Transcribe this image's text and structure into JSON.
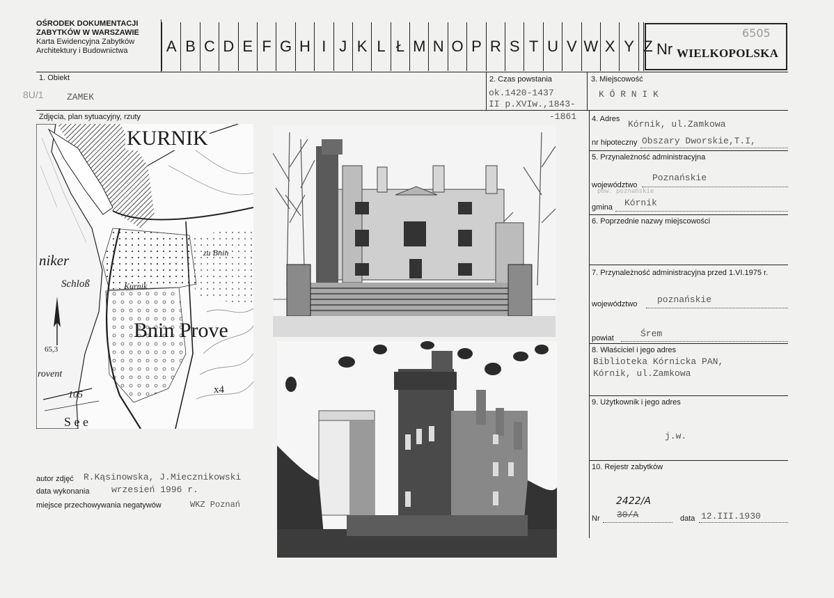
{
  "header": {
    "org_line1": "OŚRODEK DOKUMENTACJI",
    "org_line2": "ZABYTKÓW W WARSZAWIE",
    "org_line3": "Karta Ewidencyjna Zabytków",
    "org_line4": "Architektury i Budownictwa",
    "letters": [
      "A",
      "B",
      "C",
      "D",
      "E",
      "F",
      "G",
      "H",
      "I",
      "J",
      "K",
      "L",
      "Ł",
      "M",
      "N",
      "O",
      "P",
      "R",
      "S",
      "T",
      "U",
      "V",
      "W",
      "X",
      "Y",
      "Z"
    ],
    "nr_label": "Nr",
    "nr_handwritten": "6505",
    "region_stamp": "WIELKOPOLSKA"
  },
  "fields": {
    "obiekt_label": "1. Obiekt",
    "obiekt_margin_note": "8U/1",
    "obiekt_value": "ZAMEK",
    "czas_label": "2. Czas powstania",
    "czas_line1": "ok.1420-1437",
    "czas_line2": "II p.XVIw.,1843-",
    "czas_line3": "-1861",
    "miejscowosc_label": "3. Miejscowość",
    "miejscowosc_value": "K Ó R N I K",
    "zdjecia_label": "Zdjęcia, plan sytuacyjny, rzuty",
    "adres_label": "4. Adres",
    "adres_value": "Kórnik, ul.Zamkowa",
    "hipoteczny_label": "nr hipoteczny",
    "hipoteczny_value": "Obszary Dworskie,T.I,",
    "przynaleznosc_label": "5. Przynależność administracyjna",
    "wojewodztwo_label": "województwo",
    "wojewodztwo_value": "Poznańskie",
    "wojewodztwo_faint": "pow. poznańskie",
    "gmina_label": "gmina",
    "gmina_value": "Kórnik",
    "poprzednie_label": "6. Poprzednie nazwy miejscowości",
    "przed_label": "7. Przynależność administracyjna przed 1.VI.1975 r.",
    "wojewodztwo2_label": "województwo",
    "wojewodztwo2_value": "poznańskie",
    "powiat_label": "powiat",
    "powiat_value": "Śrem",
    "wlasciciel_label": "8. Właściciel i jego adres",
    "wlasciciel_line1": "Biblioteka Kórnicka PAN,",
    "wlasciciel_line2": "Kórnik, ul.Zamkowa",
    "uzytkownik_label": "9. Użytkownik i jego adres",
    "uzytkownik_value": "j.w.",
    "rejestr_label": "10. Rejestr zabytków",
    "nr2_label": "Nr",
    "nr2_handwritten": "2422/A",
    "nr2_struck": "30/A",
    "data_label": "data",
    "data_value": "12.III.1930"
  },
  "map": {
    "title": "KURNIK",
    "label_niker": "niker",
    "label_schloss": "Schloß",
    "label_kurnik": "Kurnik",
    "label_bnin": "Bnin Prove",
    "label_zu_bnin": "zu Bnin",
    "label_elev": "65,3",
    "label_provent": "rovent",
    "label_see": "S e e",
    "label_105": "105",
    "label_x4": "x4"
  },
  "credits": {
    "autor_label": "autor zdjęć",
    "autor_value": "R.Kąsinowska, J.Miecznikowski",
    "data_label": "data wykonania",
    "data_value": "wrzesień 1996 r.",
    "miejsce_label": "miejsce przechowywania negatywów",
    "miejsce_value": "WKZ Poznań"
  },
  "colors": {
    "paper": "#f1f1f0",
    "ink": "#1b1b1b",
    "typewriter": "#555555",
    "pencil": "#9a9a9a"
  }
}
